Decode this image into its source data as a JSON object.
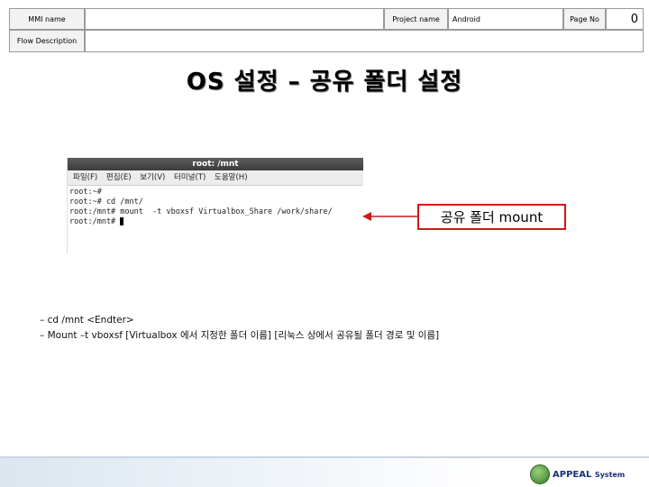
{
  "header": {
    "mmi_name_label": "MMI name",
    "mmi_name_value": "",
    "project_name_label": "Project name",
    "project_name_value": "Android",
    "page_no_label": "Page No",
    "page_no_value": "0",
    "flow_description_label": "Flow Description",
    "flow_description_value": ""
  },
  "title": "OS 설정 – 공유 폴더 설정",
  "terminal": {
    "title": "root: /mnt",
    "menu": [
      "파일(F)",
      "편집(E)",
      "보기(V)",
      "터미널(T)",
      "도움말(H)"
    ],
    "lines": [
      "root:~#",
      "root:~# cd /mnt/",
      "root:/mnt# mount  -t vboxsf Virtualbox_Share /work/share/",
      "root:/mnt# "
    ]
  },
  "callout": "공유 폴더 mount",
  "description": [
    "– cd /mnt <Endter>",
    "– Mount –t vboxsf [Virtualbox 에서 지정한 폴더 이름] [리눅스 상에서 공유될 폴더 경로 및 이름]"
  ],
  "footer": {
    "logo_main": "APPEAL",
    "logo_sub": "System"
  },
  "colors": {
    "callout_border": "#d01818",
    "logo_text": "#1b2f7a"
  }
}
